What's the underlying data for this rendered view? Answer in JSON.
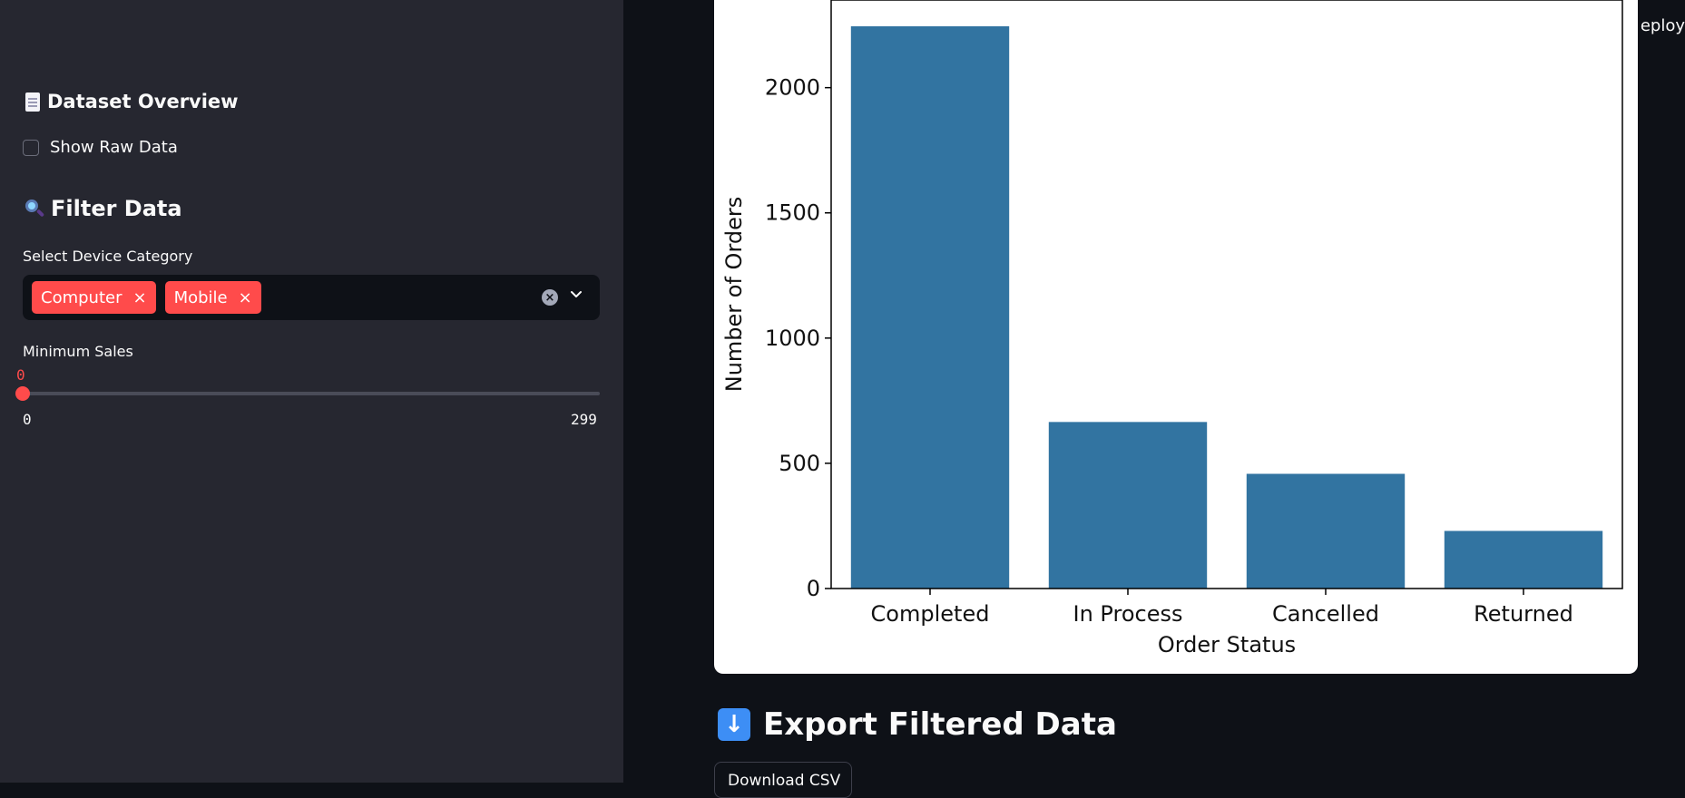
{
  "sidebar": {
    "overview_heading": "Dataset Overview",
    "show_raw_label": "Show Raw Data",
    "show_raw_checked": false,
    "filter_heading": "Filter Data",
    "device_label": "Select Device Category",
    "device_tags": [
      "Computer",
      "Mobile"
    ],
    "tag_close": "×",
    "min_sales_label": "Minimum Sales",
    "slider": {
      "value": "0",
      "min": "0",
      "max": "299"
    }
  },
  "header": {
    "deploy_text": "eploy"
  },
  "main": {
    "export_heading": "Export Filtered Data",
    "download_label": "Download CSV"
  },
  "chart_data": {
    "type": "bar",
    "categories": [
      "Completed",
      "In Process",
      "Cancelled",
      "Returned"
    ],
    "values": [
      2245,
      665,
      458,
      230
    ],
    "xlabel": "Order Status",
    "ylabel": "Number of Orders",
    "yticks": [
      0,
      500,
      1000,
      1500,
      2000
    ],
    "ylim": [
      0,
      2350
    ],
    "bar_color": "#3274a1",
    "grid": false
  },
  "colors": {
    "accent": "#ff4b4b",
    "sidebar_bg": "#262730",
    "main_bg": "#0e1117"
  }
}
